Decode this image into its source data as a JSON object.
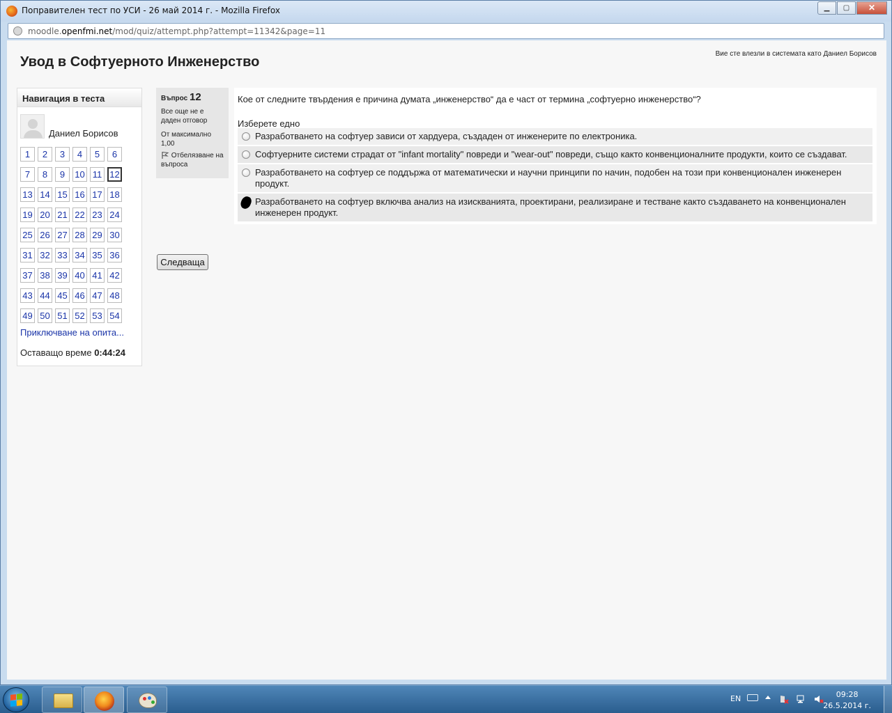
{
  "window": {
    "title": "Поправителен тест по УСИ - 26 май 2014 г. - Mozilla Firefox",
    "controls": {
      "minimize": "▁",
      "maximize": "▢",
      "close": "✕"
    }
  },
  "address_bar": {
    "host_prefix": "moodle.",
    "host_main": "openfmi.net",
    "path": "/mod/quiz/attempt.php?attempt=11342&page=11"
  },
  "header": {
    "site_title": "Увод в Софтуерното Инженерство",
    "login_info": "Вие сте влезли в системата като Даниел Борисов"
  },
  "quiz_navigation": {
    "title": "Навигация в теста",
    "user_name": "Даниел Борисов",
    "questions": [
      "1",
      "2",
      "3",
      "4",
      "5",
      "6",
      "7",
      "8",
      "9",
      "10",
      "11",
      "12",
      "13",
      "14",
      "15",
      "16",
      "17",
      "18",
      "19",
      "20",
      "21",
      "22",
      "23",
      "24",
      "25",
      "26",
      "27",
      "28",
      "29",
      "30",
      "31",
      "32",
      "33",
      "34",
      "35",
      "36",
      "37",
      "38",
      "39",
      "40",
      "41",
      "42",
      "43",
      "44",
      "45",
      "46",
      "47",
      "48",
      "49",
      "50",
      "51",
      "52",
      "53",
      "54"
    ],
    "current_question": "12",
    "finish_link": "Приключване на опита...",
    "time_left_label": "Оставащо време",
    "time_left_value": "0:44:24"
  },
  "question_info": {
    "label": "Въпрос",
    "number": "12",
    "status": "Все още не е даден отговор",
    "grade": "От максимално 1,00",
    "flag_label": "Отбелязване на въпроса"
  },
  "question": {
    "text": "Кое от следните твърдения е причина думата „инженерство“ да е част от термина „софтуерно инженерство“?",
    "prompt": "Изберете едно",
    "answers": [
      {
        "text": "Разработването на софтуер зависи от хардуера, създаден от инженерите по електроника.",
        "selected": false
      },
      {
        "text": "Софтуерните системи страдат от \"infant mortality\" повреди и \"wear-out\" повреди, също както конвенционалните продукти, които се създават.",
        "selected": false
      },
      {
        "text": "Разработването на софтуер се поддържа от математически и научни принципи по начин, подобен на този при конвенционален инженерен продукт.",
        "selected": false
      },
      {
        "text": "Разработването на софтуер включва анализ на изискванията, проектирани, реализиране и тестване както създаването на конвенционален инженерен продукт.",
        "selected": true
      }
    ]
  },
  "buttons": {
    "next": "Следваща"
  },
  "taskbar": {
    "language": "EN",
    "time": "09:28",
    "date": "26.5.2014 г."
  }
}
